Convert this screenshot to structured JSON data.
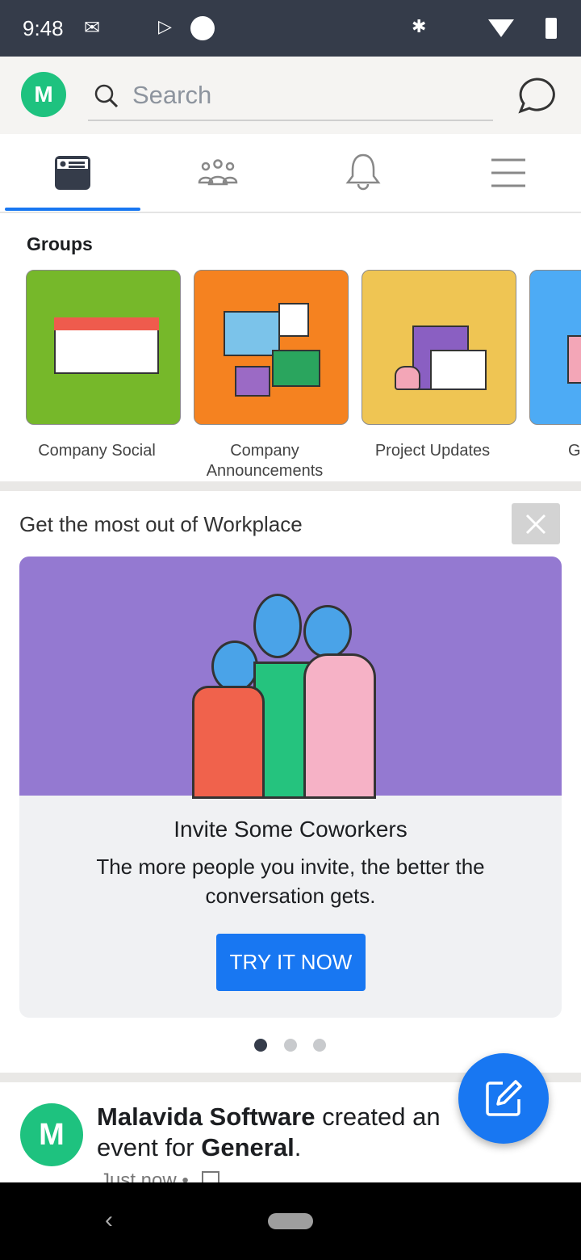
{
  "status_bar": {
    "time": "9:48"
  },
  "header": {
    "avatar_letter": "M",
    "search_placeholder": "Search"
  },
  "tabs": [
    {
      "name": "news-feed",
      "active": true
    },
    {
      "name": "groups"
    },
    {
      "name": "notifications"
    },
    {
      "name": "menu"
    }
  ],
  "groups": {
    "title": "Groups",
    "items": [
      {
        "label": "Company Social",
        "color": "#76b82a"
      },
      {
        "label": "Company Announcements",
        "color": "#f58220"
      },
      {
        "label": "Project Updates",
        "color": "#efc553"
      },
      {
        "label": "G",
        "color": "#4dabf5"
      }
    ]
  },
  "promo": {
    "section_title": "Get the most out of Workplace",
    "heading": "Invite Some Coworkers",
    "body": "The more people you invite, the better the conversation gets.",
    "button": "TRY IT NOW",
    "pages": 3,
    "active_page": 1,
    "illustration_color": "#9479d1"
  },
  "post": {
    "avatar_letter": "M",
    "author": "Malavida Software",
    "action": " created an event for ",
    "group": "General",
    "end": ".",
    "meta": "Just now •"
  },
  "colors": {
    "accent": "#1877f2",
    "status_bar": "#353c4a",
    "avatar": "#1ec27f"
  }
}
